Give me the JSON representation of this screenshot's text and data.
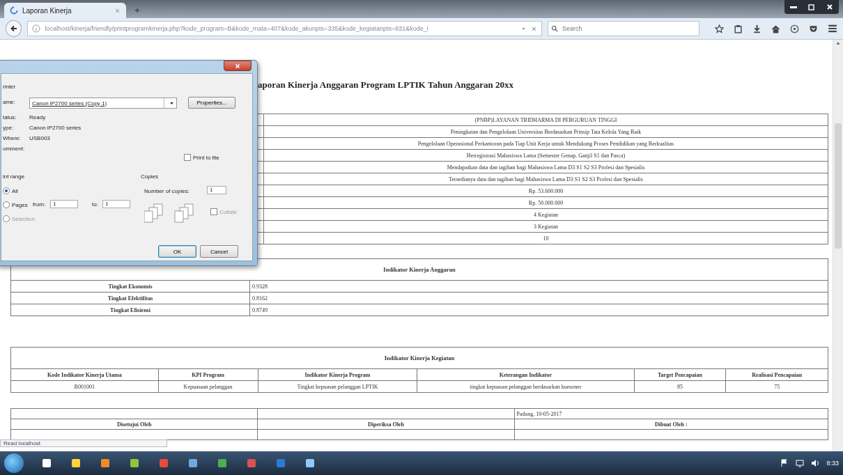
{
  "browser": {
    "tab": {
      "title": "Laporan Kinerja",
      "selected": true
    },
    "address": "localhost/kinerja/friendly/printprogramkinerja.php?kode_program=B&kode_mata=407&kode_akunpts=335&kode_kegiatanpts=831&kode_i",
    "search": {
      "placeholder": "Search"
    }
  },
  "report": {
    "title": "aporan Kinerja Anggaran Program LPTIK Tahun Anggaran 20xx",
    "info_rows": [
      "(PNBP)LAYANAN TRIDHARMA DI PERGURUAN TINGGI",
      "Peningkatan dan Pengelolaan Universitas Berdasarkan Prinsip Tata Kelola Yang Baik",
      "Pengelolaan Operasional Perkantoran pada Tiap Unit Kerja untuk Mendukung Proses Pendidikan yang Berkualitas",
      "Herregistrasi Mahasiswa Lama (Semester Genap, Ganjil S1 dan Pasca)",
      "Mendapatkan data dan tagihan bagi Mahasiswa Lama D3 S1 S2 S3 Profesi dan Spesialis",
      "Tersedianya data dan tagihan bagi Mahasiswa Lama D3 S1 S2 S3 Profesi dan Spesialis",
      "Rp. 53.600.000",
      "Rp. 50.000.000",
      "4 Kegiatan",
      "3 Kegiatan",
      "10"
    ],
    "budget_indicators": {
      "title": "Indikator Kinerja Anggaran",
      "rows": [
        {
          "label": "Tingkat Ekonomis",
          "value": "0.9328"
        },
        {
          "label": "Tingkat Efektifitas",
          "value": "0.8162"
        },
        {
          "label": "Tingkat Efisiensi",
          "value": "0.8749"
        }
      ]
    },
    "activity_indicators": {
      "title": "Indikator Kinerja Kegiatan",
      "columns": [
        "Kode Indikator Kinerja Utama",
        "KPI Program",
        "Indikator Kinerja Program",
        "Keterangan Indikator",
        "Target Pencapaian",
        "Realisasi Pencapaian"
      ],
      "rows": [
        [
          "B001001",
          "Kepuasaan pelanggan",
          "Tingkat kepuasan pelanggan LPTIK",
          "tingkat kepuasan pelanggan berdasarkan kuesoner",
          "85",
          "75"
        ]
      ]
    },
    "signatures": {
      "place_date": "Padang, 10-05-2017",
      "columns": [
        "Disetujui Oleh",
        "Diperiksa Oleh",
        "Dibuat Oleh :"
      ]
    }
  },
  "status_bar": "Read localhost",
  "print_dialog": {
    "group_printer": "rinter",
    "name_label": "ame:",
    "printer": "Canon iP2700 series (Copy 1)",
    "properties_button": "Properties...",
    "details": [
      {
        "label": "tatus:",
        "value": "Ready"
      },
      {
        "label": "ype:",
        "value": "Canon iP2700 series"
      },
      {
        "label": "Where:",
        "value": "USB003"
      },
      {
        "label": "omment:"
      }
    ],
    "print_to_file": {
      "label": "Print to file",
      "checked": false
    },
    "range_title": "int range",
    "range_options": [
      {
        "label": "All",
        "selected": true,
        "disabled": false
      },
      {
        "label": "Pages",
        "selected": false,
        "disabled": false
      },
      {
        "label": "Selection",
        "selected": false,
        "disabled": true
      }
    ],
    "from_label": "from:",
    "from_value": "1",
    "to_label": "to:",
    "to_value": "1",
    "copies_title": "Copies",
    "copies_label": "Number of copies:",
    "copies_value": "1",
    "collate": {
      "label": "Collate",
      "checked": false,
      "disabled": true
    },
    "buttons": [
      "OK",
      "Cancel"
    ]
  },
  "taskbar": {
    "clock": "8:33"
  }
}
